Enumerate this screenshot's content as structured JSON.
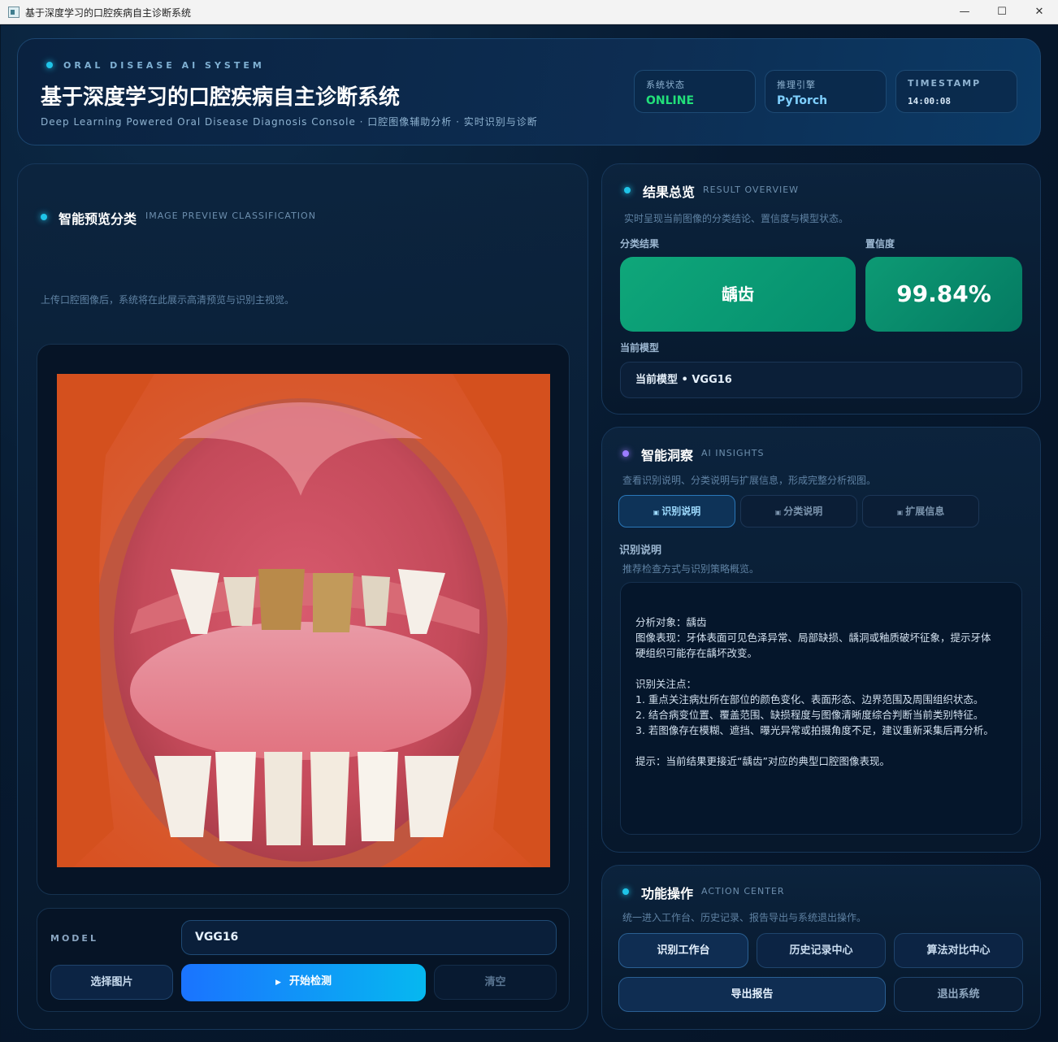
{
  "window": {
    "title": "基于深度学习的口腔疾病自主诊断系统",
    "minimize": "—",
    "maximize": "☐",
    "close": "✕"
  },
  "header": {
    "eyebrow": "ORAL DISEASE AI SYSTEM",
    "title": "基于深度学习的口腔疾病自主诊断系统",
    "subtitle": "Deep Learning Powered Oral Disease Diagnosis Console · 口腔图像辅助分析 · 实时识别与诊断",
    "stats": [
      {
        "key": "系统状态",
        "value": "ONLINE",
        "color": "#22e07a"
      },
      {
        "key": "推理引擎",
        "value": "PyTorch",
        "color": "#7fd0ff"
      },
      {
        "key": "TIMESTAMP",
        "value": "14:00:08",
        "color": "#d7e8f7"
      }
    ]
  },
  "preview": {
    "title": "智能预览分类",
    "tag": "IMAGE PREVIEW CLASSIFICATION",
    "desc": "上传口腔图像后，系统将在此展示高清预览与识别主视觉。",
    "model_label": "MODEL",
    "model_value": "VGG16",
    "select_button": "选择图片",
    "detect_button": "开始检测",
    "clear_button": "清空"
  },
  "result": {
    "title": "结果总览",
    "tag": "RESULT OVERVIEW",
    "desc": "实时呈现当前图像的分类结论、置信度与模型状态。",
    "class_label": "分类结果",
    "class_value": "龋齿",
    "conf_label": "置信度",
    "conf_value": "99.84%",
    "model_label": "当前模型",
    "model_value": "当前模型 • VGG16"
  },
  "insights": {
    "title": "智能洞察",
    "tag": "AI INSIGHTS",
    "desc": "查看识别说明、分类说明与扩展信息，形成完整分析视图。",
    "tabs": [
      "识别说明",
      "分类说明",
      "扩展信息"
    ],
    "section_label": "识别说明",
    "section_desc": "推荐检查方式与识别策略概览。",
    "lines": [
      "分析对象：龋齿",
      "图像表现：牙体表面可见色泽异常、局部缺损、龋洞或釉质破坏征象，提示牙体",
      "硬组织可能存在龋坏改变。",
      "",
      "识别关注点：",
      "1. 重点关注病灶所在部位的颜色变化、表面形态、边界范围及周围组织状态。",
      "2. 结合病变位置、覆盖范围、缺损程度与图像清晰度综合判断当前类别特征。",
      "3. 若图像存在模糊、遮挡、曝光异常或拍摄角度不足，建议重新采集后再分析。",
      "",
      "提示：当前结果更接近“龋齿”对应的典型口腔图像表现。"
    ]
  },
  "actions": {
    "title": "功能操作",
    "tag": "ACTION CENTER",
    "desc": "统一进入工作台、历史记录、报告导出与系统退出操作。",
    "buttons": [
      "识别工作台",
      "历史记录中心",
      "算法对比中心",
      "导出报告",
      "退出系统"
    ]
  }
}
